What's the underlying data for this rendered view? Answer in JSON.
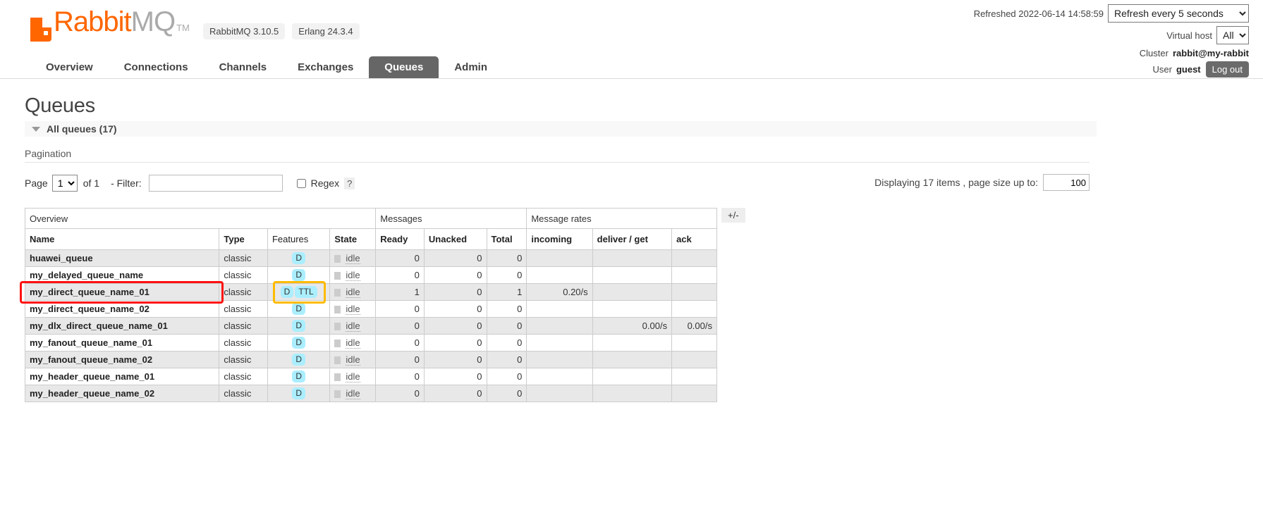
{
  "brand": {
    "name_primary": "Rabbit",
    "name_secondary": "MQ",
    "trademark": "TM",
    "server_version": "RabbitMQ 3.10.5",
    "erlang_version": "Erlang 24.3.4",
    "accent_color": "#ff6600"
  },
  "header": {
    "refreshed_label": "Refreshed 2022-06-14 14:58:59",
    "refresh_selected": "Refresh every 5 seconds",
    "refresh_options": [
      "Refresh every 5 seconds"
    ],
    "vhost_label": "Virtual host",
    "vhost_selected": "All",
    "vhost_options": [
      "All"
    ],
    "cluster_label": "Cluster",
    "cluster_name": "rabbit@my-rabbit",
    "user_label": "User",
    "user_name": "guest",
    "logout_label": "Log out"
  },
  "nav": {
    "items": [
      {
        "label": "Overview",
        "selected": false
      },
      {
        "label": "Connections",
        "selected": false
      },
      {
        "label": "Channels",
        "selected": false
      },
      {
        "label": "Exchanges",
        "selected": false
      },
      {
        "label": "Queues",
        "selected": true
      },
      {
        "label": "Admin",
        "selected": false
      }
    ]
  },
  "page": {
    "title": "Queues",
    "section_label": "All queues (17)",
    "pagination_label": "Pagination"
  },
  "filter": {
    "page_label": "Page",
    "page_selected": "1",
    "page_options": [
      "1"
    ],
    "of_label": "of 1",
    "filter_label": "- Filter:",
    "filter_value": "",
    "filter_placeholder": "",
    "regex_label": "Regex",
    "regex_checked": false,
    "help_label": "?",
    "displaying_label": "Displaying 17 items , page size up to:",
    "page_size_value": "100"
  },
  "table": {
    "group_headers": [
      {
        "label": "Overview",
        "span": 4
      },
      {
        "label": "Messages",
        "span": 3
      },
      {
        "label": "Message rates",
        "span": 3
      }
    ],
    "columns": [
      {
        "label": "Name",
        "bold": true
      },
      {
        "label": "Type",
        "bold": true
      },
      {
        "label": "Features",
        "bold": false
      },
      {
        "label": "State",
        "bold": true
      },
      {
        "label": "Ready",
        "bold": true
      },
      {
        "label": "Unacked",
        "bold": true
      },
      {
        "label": "Total",
        "bold": true
      },
      {
        "label": "incoming",
        "bold": true
      },
      {
        "label": "deliver / get",
        "bold": true
      },
      {
        "label": "ack",
        "bold": true
      }
    ],
    "toggle_columns_label": "+/-",
    "rows": [
      {
        "name": "huawei_queue",
        "type": "classic",
        "features": [
          "D"
        ],
        "state": "idle",
        "ready": "0",
        "unacked": "0",
        "total": "0",
        "incoming": "",
        "deliver_get": "",
        "ack": ""
      },
      {
        "name": "my_delayed_queue_name",
        "type": "classic",
        "features": [
          "D"
        ],
        "state": "idle",
        "ready": "0",
        "unacked": "0",
        "total": "0",
        "incoming": "",
        "deliver_get": "",
        "ack": ""
      },
      {
        "name": "my_direct_queue_name_01",
        "type": "classic",
        "features": [
          "D",
          "TTL"
        ],
        "state": "idle",
        "ready": "1",
        "unacked": "0",
        "total": "1",
        "incoming": "0.20/s",
        "deliver_get": "",
        "ack": ""
      },
      {
        "name": "my_direct_queue_name_02",
        "type": "classic",
        "features": [
          "D"
        ],
        "state": "idle",
        "ready": "0",
        "unacked": "0",
        "total": "0",
        "incoming": "",
        "deliver_get": "",
        "ack": ""
      },
      {
        "name": "my_dlx_direct_queue_name_01",
        "type": "classic",
        "features": [
          "D"
        ],
        "state": "idle",
        "ready": "0",
        "unacked": "0",
        "total": "0",
        "incoming": "",
        "deliver_get": "0.00/s",
        "ack": "0.00/s"
      },
      {
        "name": "my_fanout_queue_name_01",
        "type": "classic",
        "features": [
          "D"
        ],
        "state": "idle",
        "ready": "0",
        "unacked": "0",
        "total": "0",
        "incoming": "",
        "deliver_get": "",
        "ack": ""
      },
      {
        "name": "my_fanout_queue_name_02",
        "type": "classic",
        "features": [
          "D"
        ],
        "state": "idle",
        "ready": "0",
        "unacked": "0",
        "total": "0",
        "incoming": "",
        "deliver_get": "",
        "ack": ""
      },
      {
        "name": "my_header_queue_name_01",
        "type": "classic",
        "features": [
          "D"
        ],
        "state": "idle",
        "ready": "0",
        "unacked": "0",
        "total": "0",
        "incoming": "",
        "deliver_get": "",
        "ack": ""
      },
      {
        "name": "my_header_queue_name_02",
        "type": "classic",
        "features": [
          "D"
        ],
        "state": "idle",
        "ready": "0",
        "unacked": "0",
        "total": "0",
        "incoming": "",
        "deliver_get": "",
        "ack": ""
      }
    ]
  },
  "annotations": {
    "colors": {
      "name_highlight": "#ff1111",
      "features_highlight": "#ffbb00"
    }
  }
}
